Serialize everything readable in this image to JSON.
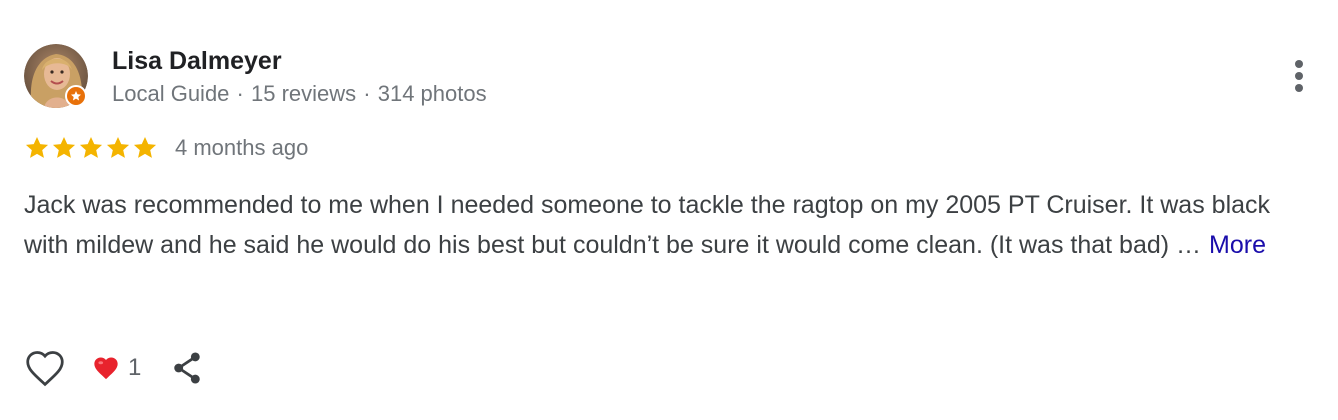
{
  "reviewer": {
    "name": "Lisa Dalmeyer",
    "role": "Local Guide",
    "separator": "·",
    "reviews": "15 reviews",
    "photos": "314 photos"
  },
  "review": {
    "rating": 5,
    "max_rating": 5,
    "date": "4 months ago",
    "text": "Jack was recommended to me when I needed someone to tackle the ragtop on my 2005 PT Cruiser. It was black with mildew and he said he would do his best but couldn’t be sure it would come clean. (It was that bad) …",
    "more_label": "More"
  },
  "actions": {
    "reaction_count": "1"
  },
  "icons": {
    "avatar": "avatar-photo",
    "badge": "local-guide-star-icon",
    "menu": "more-vert-icon",
    "like": "heart-outline-icon",
    "reaction": "red-heart-icon",
    "share": "share-icon"
  },
  "colors": {
    "star": "#f4b400",
    "link": "#1a0dab",
    "badge": "#e8710a",
    "meta": "#70757a",
    "body_text": "#3c4043",
    "heart": "#e8232d"
  }
}
